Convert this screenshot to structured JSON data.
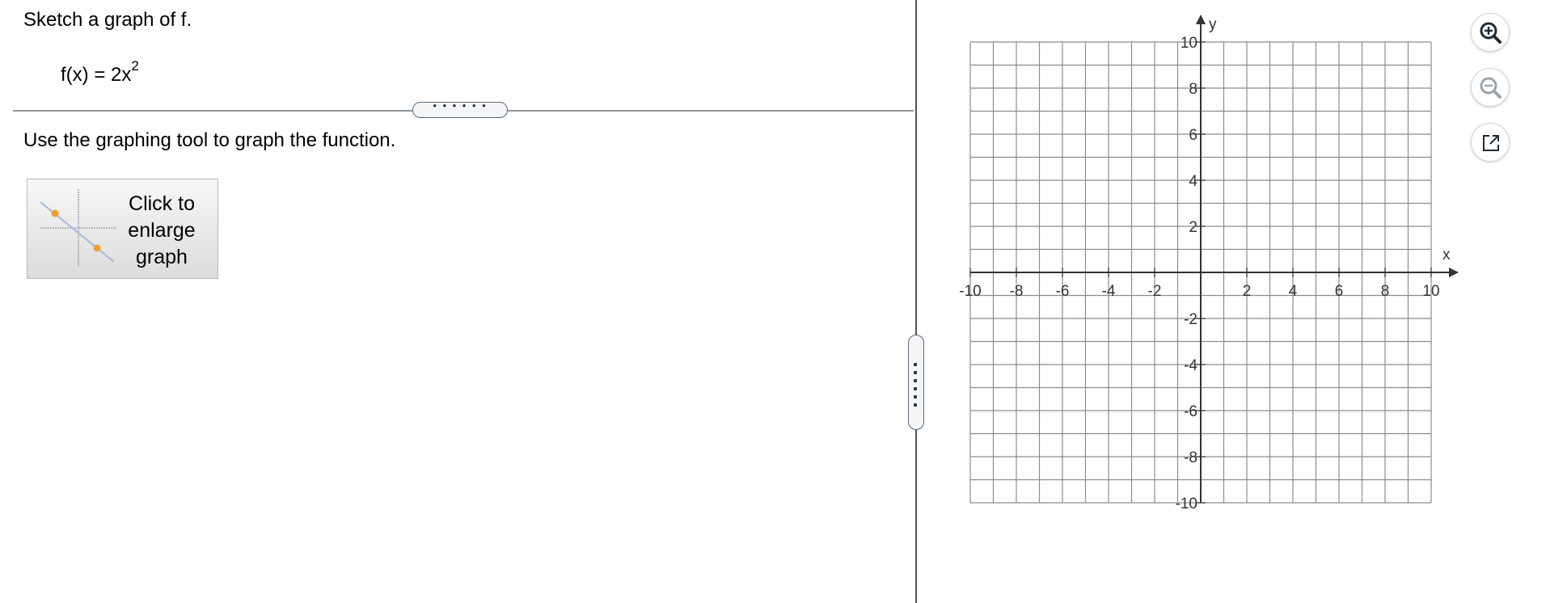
{
  "question": {
    "prompt": "Sketch a graph of f.",
    "formula": {
      "lhs": "f(x) = 2x",
      "exponent": "2"
    },
    "instruction": "Use the graphing tool to graph the function."
  },
  "dividers": {
    "horizontal_grip": "• • • • • •"
  },
  "enlarge_button": {
    "label": "Click to\nenlarge\ngraph",
    "icon": "line-graph-thumbnail-icon"
  },
  "graph": {
    "x_axis_label": "x",
    "y_axis_label": "y",
    "x_min": -10,
    "x_max": 10,
    "y_min": -10,
    "y_max": 10,
    "grid_step": 1,
    "x_tick_labels": [
      "-10",
      "-8",
      "-6",
      "-4",
      "-2",
      "2",
      "4",
      "6",
      "8",
      "10"
    ],
    "y_tick_labels": [
      "10",
      "8",
      "6",
      "4",
      "2",
      "-2",
      "-4",
      "-6",
      "-8",
      "-10"
    ],
    "grid": true,
    "colors": {
      "grid": "#8c8c8c",
      "axis": "#333333"
    }
  },
  "toolbar": {
    "zoom_in": {
      "icon": "zoom-in-icon"
    },
    "zoom_out": {
      "icon": "zoom-out-icon"
    },
    "pop_out": {
      "icon": "pop-out-icon"
    }
  },
  "colors": {
    "accent": "#3a4756",
    "thumbnail_line": "#a9b8dc",
    "thumbnail_point": "#f0a030"
  }
}
